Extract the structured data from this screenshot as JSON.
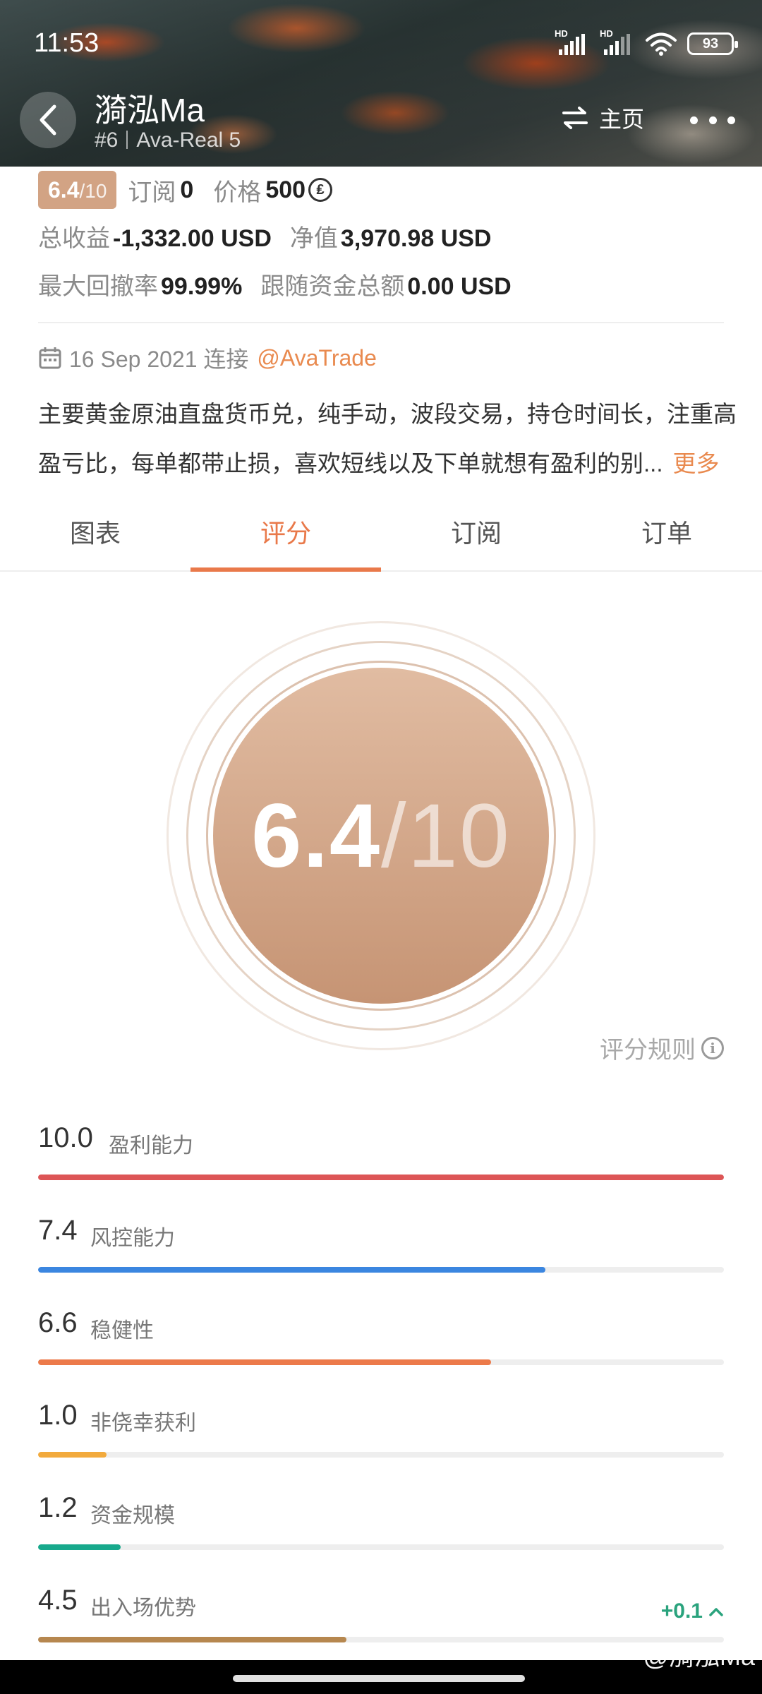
{
  "status": {
    "time": "11:53",
    "hd1": "HD",
    "hd2": "HD",
    "battery": "93"
  },
  "nav": {
    "title": "漪泓Ma",
    "rank": "#6",
    "account": "Ava-Real 5",
    "home_label": "主页"
  },
  "summary": {
    "score": "6.4",
    "score_den": "/10",
    "subscribe_label": "订阅",
    "subscribe_value": "0",
    "price_label": "价格",
    "price_value": "500",
    "coin_symbol": "₤",
    "total_profit_label": "总收益",
    "total_profit_value": "-1,332.00 USD",
    "net_value_label": "净值",
    "net_value_value": "3,970.98 USD",
    "max_drawdown_label": "最大回撤率",
    "max_drawdown_value": "99.99%",
    "follow_funds_label": "跟随资金总额",
    "follow_funds_value": "0.00 USD",
    "connect_date": "16 Sep 2021 连接",
    "broker": "@AvaTrade",
    "description": "主要黄金原油直盘货币兑，纯手动，波段交易，持仓时间长，注重高盈亏比，每单都带止损，喜欢短线以及下单就想有盈利的别...",
    "more_label": "更多"
  },
  "tabs": [
    "图表",
    "评分",
    "订阅",
    "订单"
  ],
  "active_tab": 1,
  "score_circle": {
    "value": "6.4",
    "den": "/10"
  },
  "rule_label": "评分规则",
  "metrics": [
    {
      "value": "10.0",
      "label": "盈利能力",
      "score": 10.0,
      "color": "#dd5556"
    },
    {
      "value": "7.4",
      "label": "风控能力",
      "score": 7.4,
      "color": "#3b86e0"
    },
    {
      "value": "6.6",
      "label": "稳健性",
      "score": 6.6,
      "color": "#ec7a4a"
    },
    {
      "value": "1.0",
      "label": "非侥幸获利",
      "score": 1.0,
      "color": "#f2aa3d"
    },
    {
      "value": "1.2",
      "label": "资金规模",
      "score": 1.2,
      "color": "#17a98c"
    },
    {
      "value": "4.5",
      "label": "出入场优势",
      "score": 4.5,
      "color": "#b6874f"
    }
  ],
  "metrics_max": 10,
  "delta": "+0.1",
  "watermark": "@漪泓Ma"
}
